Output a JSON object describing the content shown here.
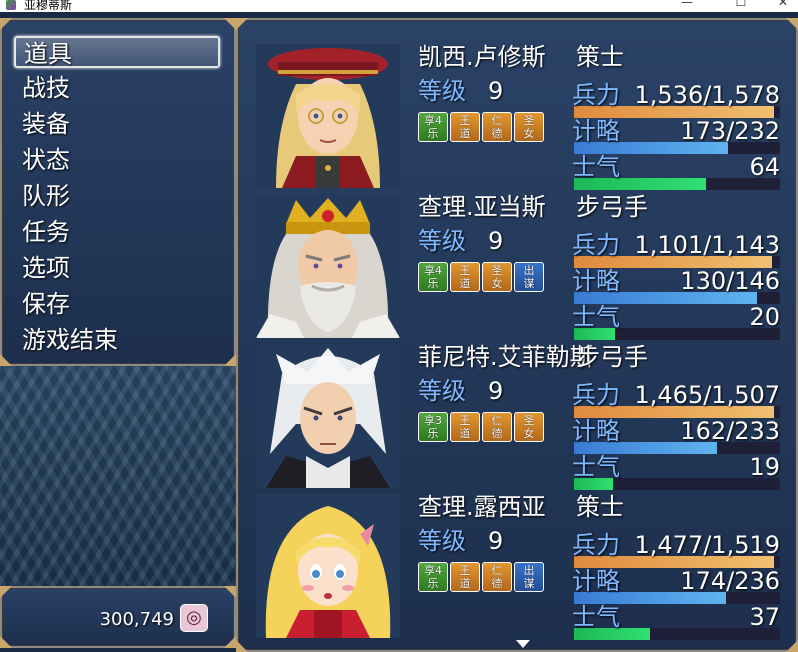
{
  "window": {
    "title": "亚穆蒂斯",
    "controls": {
      "minimize": "—",
      "maximize": "☐",
      "close": "✕"
    }
  },
  "menu": {
    "items": [
      {
        "label": "道具",
        "selected": true
      },
      {
        "label": "战技"
      },
      {
        "label": "装备"
      },
      {
        "label": "状态"
      },
      {
        "label": "队形"
      },
      {
        "label": "任务"
      },
      {
        "label": "选项"
      },
      {
        "label": "保存"
      },
      {
        "label": "游戏结束"
      }
    ]
  },
  "gold": {
    "value": "300,749",
    "icon": "currency-icon"
  },
  "labels": {
    "level": "等级",
    "hp": "兵力",
    "mp": "计略",
    "morale": "士气"
  },
  "party": [
    {
      "name": "凯西.卢修斯",
      "class": "策士",
      "level": "9",
      "states": [
        {
          "top": "享4",
          "bottom": "乐",
          "color": "green"
        },
        {
          "top": "王",
          "bottom": "道",
          "color": "orange"
        },
        {
          "top": "仁",
          "bottom": "德",
          "color": "orange"
        },
        {
          "top": "圣",
          "bottom": "女",
          "color": "orange"
        }
      ],
      "hp": "1,536/1,578",
      "hp_ratio": 0.973,
      "mp": "173/232",
      "mp_ratio": 0.746,
      "morale": "64",
      "morale_ratio": 0.64,
      "portrait": "portrait-scholar-with-red-hat"
    },
    {
      "name": "查理.亚当斯",
      "class": "步弓手",
      "level": "9",
      "states": [
        {
          "top": "享4",
          "bottom": "乐",
          "color": "green"
        },
        {
          "top": "王",
          "bottom": "道",
          "color": "orange"
        },
        {
          "top": "圣",
          "bottom": "女",
          "color": "orange"
        },
        {
          "top": "出",
          "bottom": "谋",
          "color": "blue"
        }
      ],
      "hp": "1,101/1,143",
      "hp_ratio": 0.963,
      "mp": "130/146",
      "mp_ratio": 0.89,
      "morale": "20",
      "morale_ratio": 0.2,
      "portrait": "portrait-crowned-king"
    },
    {
      "name": "菲尼特.艾菲勒斯",
      "class": "步弓手",
      "level": "9",
      "states": [
        {
          "top": "享3",
          "bottom": "乐",
          "color": "green"
        },
        {
          "top": "王",
          "bottom": "道",
          "color": "orange"
        },
        {
          "top": "仁",
          "bottom": "德",
          "color": "orange"
        },
        {
          "top": "圣",
          "bottom": "女",
          "color": "orange"
        }
      ],
      "hp": "1,465/1,507",
      "hp_ratio": 0.972,
      "mp": "162/233",
      "mp_ratio": 0.695,
      "morale": "19",
      "morale_ratio": 0.19,
      "portrait": "portrait-silver-haired-man"
    },
    {
      "name": "查理.露西亚",
      "class": "策士",
      "level": "9",
      "states": [
        {
          "top": "享4",
          "bottom": "乐",
          "color": "green"
        },
        {
          "top": "王",
          "bottom": "道",
          "color": "orange"
        },
        {
          "top": "仁",
          "bottom": "德",
          "color": "orange"
        },
        {
          "top": "出",
          "bottom": "谋",
          "color": "blue"
        }
      ],
      "hp": "1,477/1,519",
      "hp_ratio": 0.972,
      "mp": "174/236",
      "mp_ratio": 0.737,
      "morale": "37",
      "morale_ratio": 0.37,
      "portrait": "portrait-blonde-girl"
    }
  ]
}
